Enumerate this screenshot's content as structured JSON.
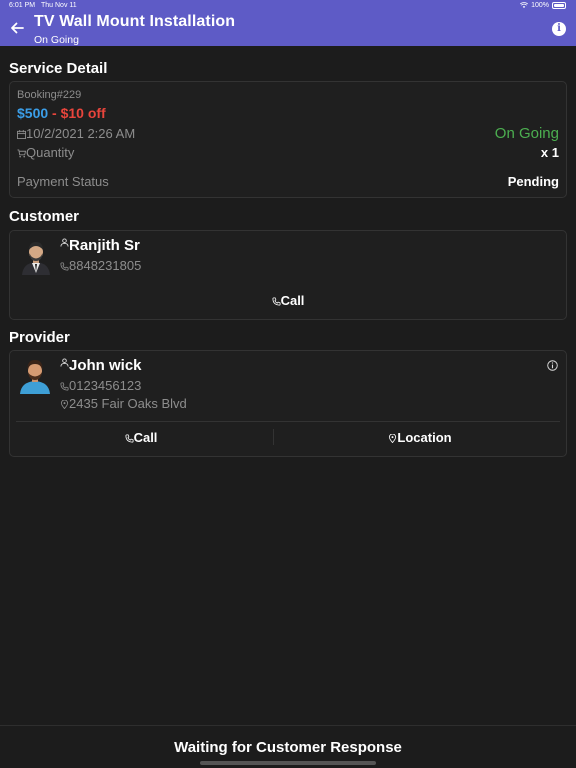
{
  "status_bar": {
    "time": "6:01 PM",
    "date": "Thu Nov 11",
    "battery": "100%"
  },
  "header": {
    "title": "TV Wall Mount Installation",
    "subtitle": "On Going"
  },
  "service": {
    "section_title": "Service Detail",
    "booking": "Booking#229",
    "price": "$500",
    "discount": "- $10 off",
    "datetime": "10/2/2021 2:26 AM",
    "status": "On Going",
    "quantity_label": "Quantity",
    "quantity_value": "x 1",
    "payment_label": "Payment Status",
    "payment_value": "Pending"
  },
  "customer": {
    "section_title": "Customer",
    "name": "Ranjith Sr",
    "phone": "8848231805",
    "call_label": "Call"
  },
  "provider": {
    "section_title": "Provider",
    "name": "John wick",
    "phone": "0123456123",
    "address": "2435 Fair Oaks Blvd",
    "call_label": "Call",
    "location_label": "Location"
  },
  "footer": {
    "message": "Waiting for Customer Response"
  },
  "colors": {
    "accent": "#5e5bc6",
    "price": "#3b9ee8",
    "discount": "#e8453c",
    "status": "#4caf50"
  }
}
